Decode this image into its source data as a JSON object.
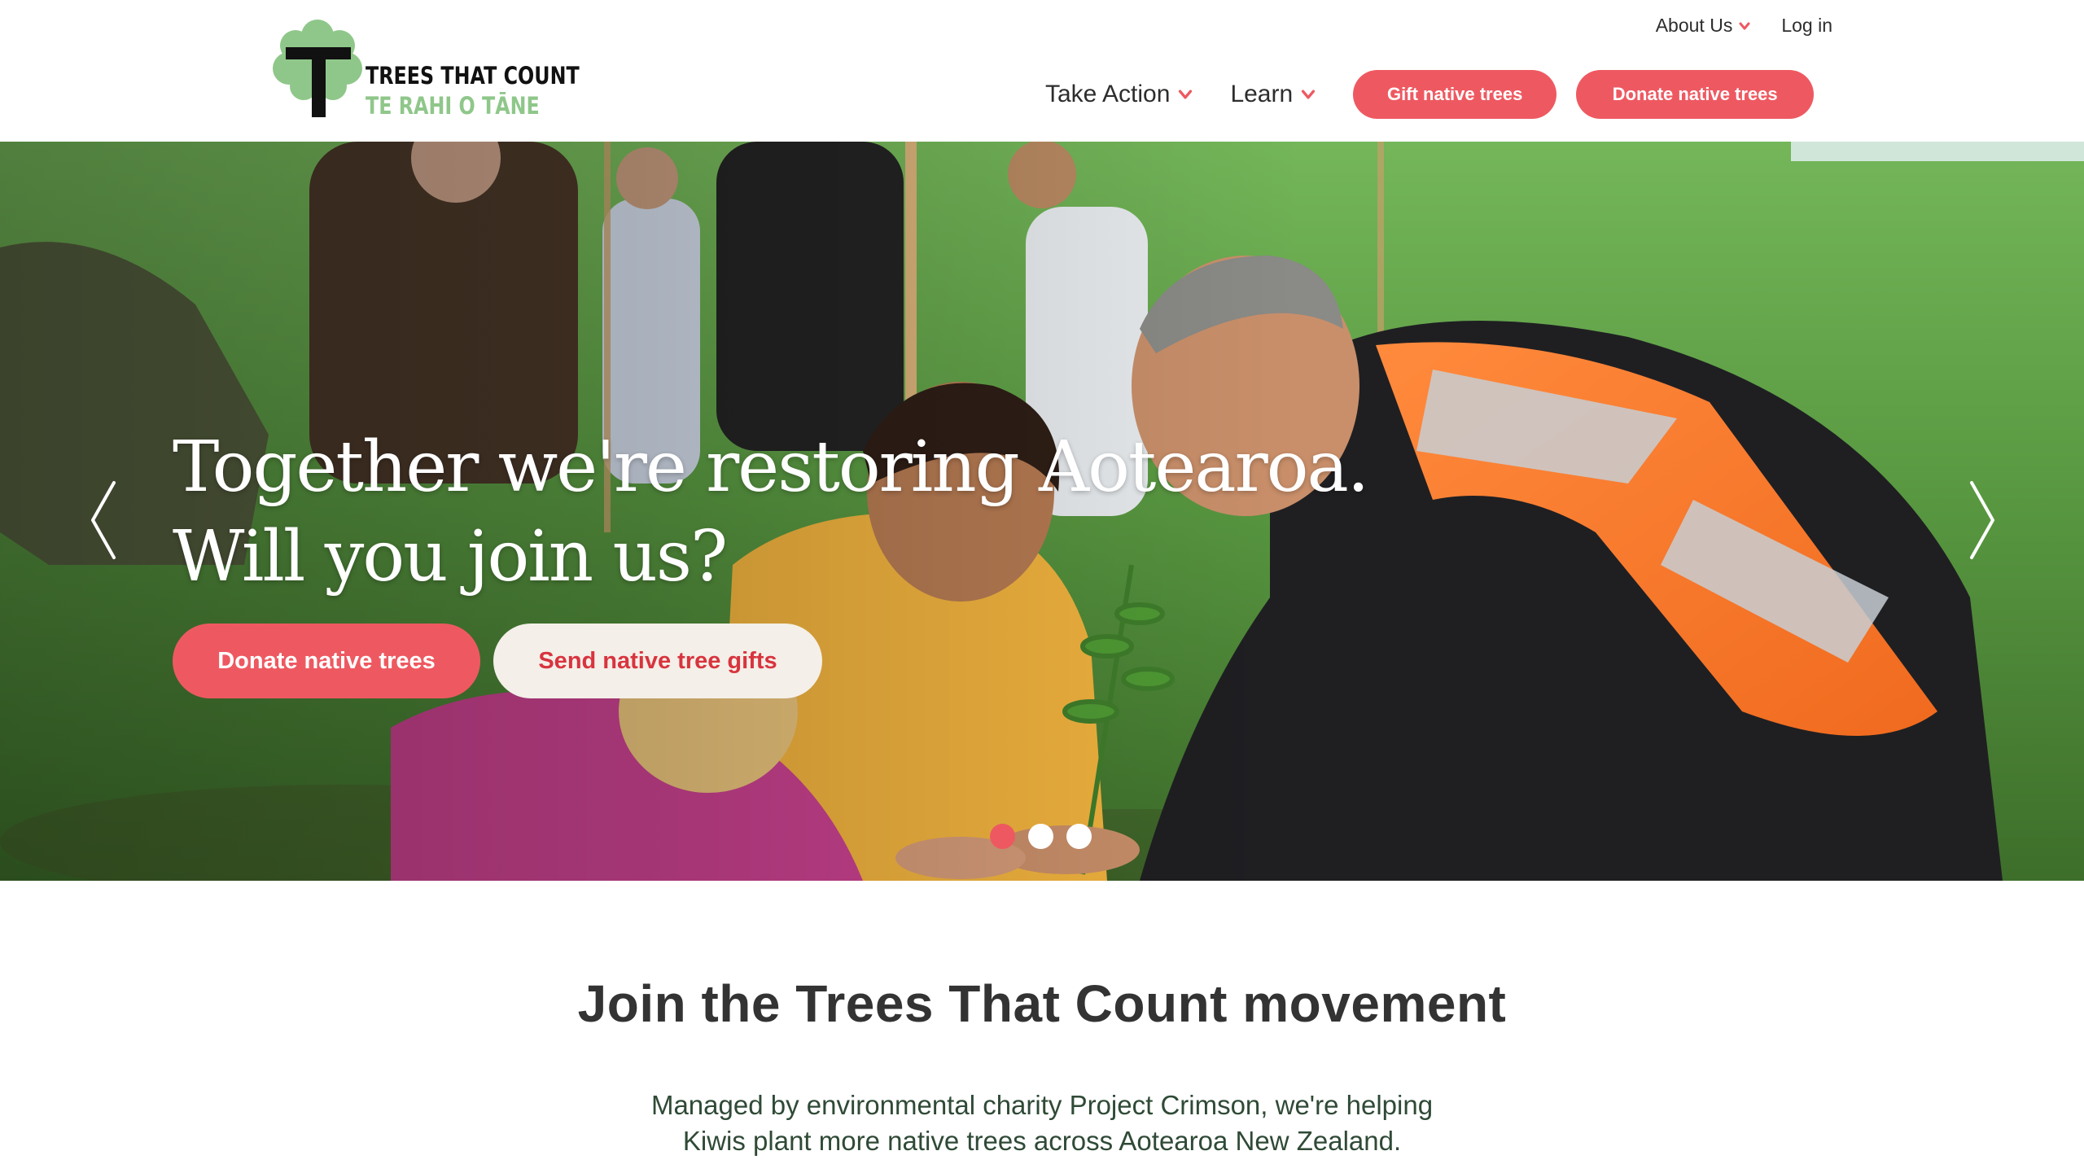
{
  "brand": {
    "name_line1": "TREES THAT COUNT",
    "name_line2": "TE RAHI O TĀNE",
    "logo_icon": "tree-t-icon",
    "colors": {
      "accent": "#ee5961",
      "logo_green": "#8fc78a",
      "dark": "#111111"
    }
  },
  "util_nav": {
    "about": "About Us",
    "login": "Log in"
  },
  "main_nav": {
    "take_action": "Take Action",
    "learn": "Learn",
    "gift_button": "Gift native trees",
    "donate_button": "Donate native trees"
  },
  "hero": {
    "title_line1": "Together we're restoring Aotearoa.",
    "title_line2": "Will you join us?",
    "primary_button": "Donate native trees",
    "secondary_button": "Send native tree gifts",
    "prev_icon": "chevron-left-icon",
    "next_icon": "chevron-right-icon",
    "slides_total": 3,
    "active_slide": 1
  },
  "intro": {
    "title": "Join the Trees That Count movement",
    "text_line1": "Managed by environmental charity Project Crimson, we're helping",
    "text_line2": "Kiwis plant more native trees across Aotearoa New Zealand."
  }
}
